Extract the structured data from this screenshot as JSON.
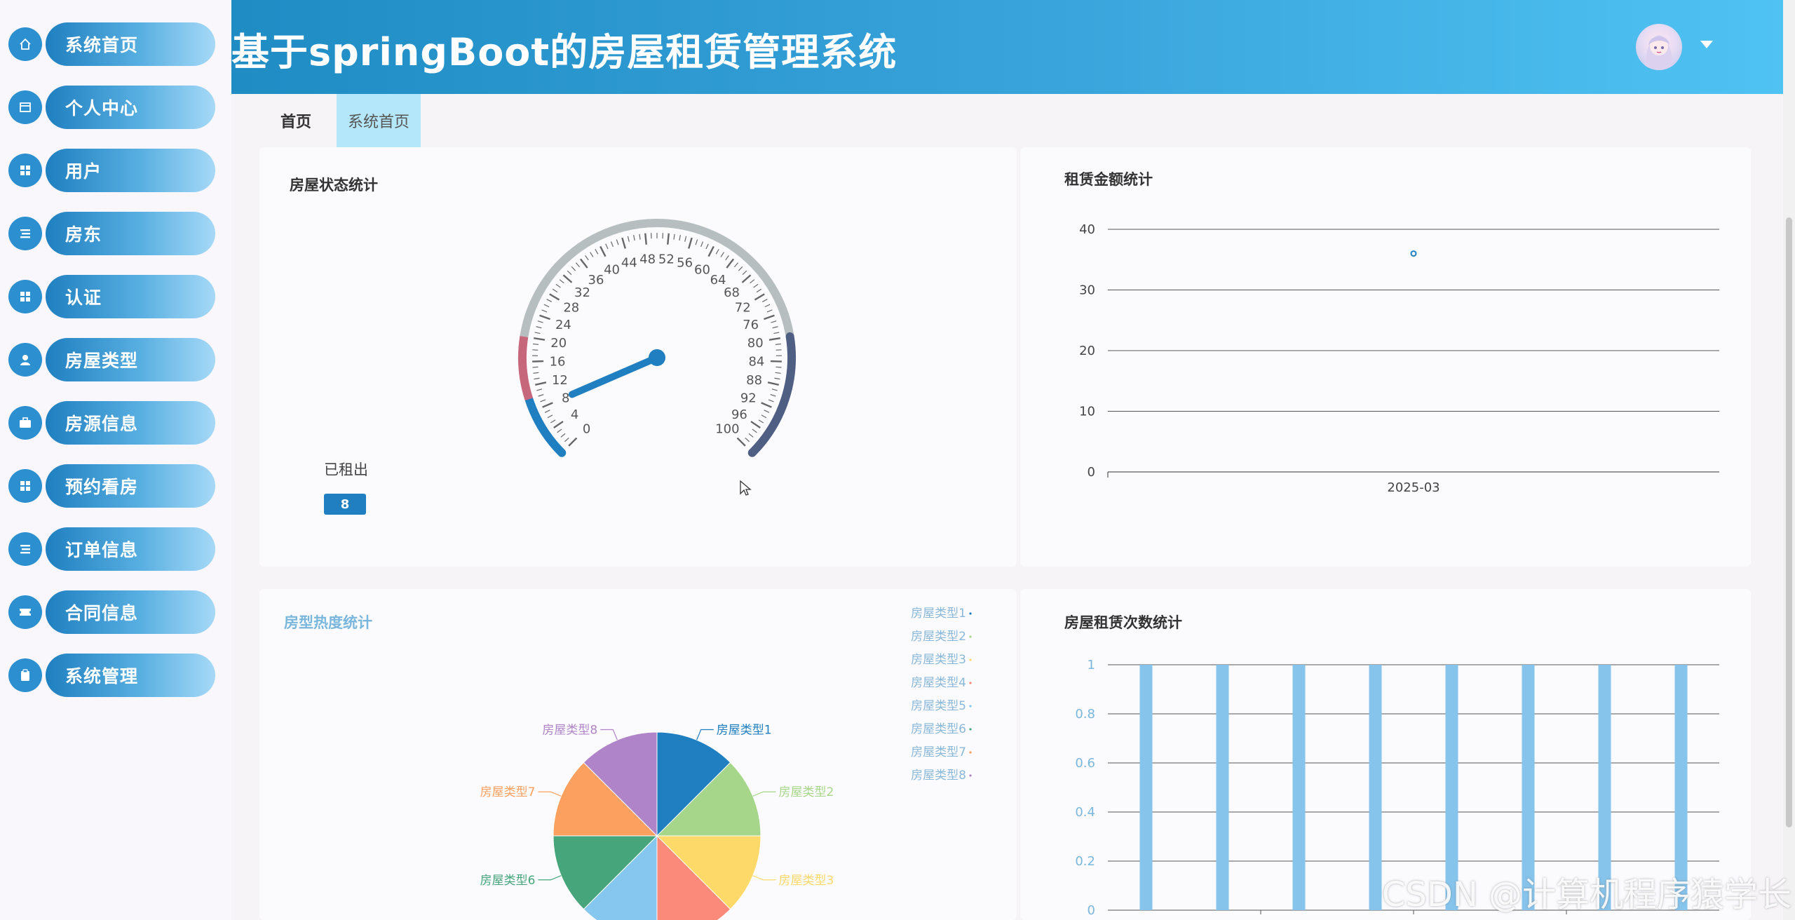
{
  "app": {
    "title": "基于springBoot的房屋租赁管理系统"
  },
  "sidebar": {
    "items": [
      {
        "label": "系统首页",
        "icon": "home-icon"
      },
      {
        "label": "个人中心",
        "icon": "card-icon"
      },
      {
        "label": "用户",
        "icon": "grid-icon"
      },
      {
        "label": "房东",
        "icon": "list-icon"
      },
      {
        "label": "认证",
        "icon": "grid-icon"
      },
      {
        "label": "房屋类型",
        "icon": "person-icon"
      },
      {
        "label": "房源信息",
        "icon": "briefcase-icon"
      },
      {
        "label": "预约看房",
        "icon": "grid-icon"
      },
      {
        "label": "订单信息",
        "icon": "list-icon"
      },
      {
        "label": "合同信息",
        "icon": "ticket-icon"
      },
      {
        "label": "系统管理",
        "icon": "clipboard-icon"
      }
    ]
  },
  "tabs": {
    "home": "首页",
    "dashboard": "系统首页"
  },
  "colors": {
    "accent": "#1f7fc0",
    "header_start": "#1f8cc4",
    "header_end": "#4fc3f3",
    "active_tab": "#b5e7fb"
  },
  "gauge_card": {
    "title": "房屋状态统计",
    "status_label": "已租出",
    "value": 8,
    "value_text": "8",
    "min": 0,
    "max": 100,
    "ticks": [
      "0",
      "4",
      "8",
      "12",
      "16",
      "20",
      "24",
      "28",
      "32",
      "36",
      "40",
      "44",
      "48",
      "52",
      "56",
      "60",
      "64",
      "68",
      "72",
      "76",
      "80",
      "84",
      "88",
      "92",
      "96",
      "100"
    ]
  },
  "cursor": {
    "icon": "mouse-pointer-icon"
  },
  "watermark": "CSDN @计算机程序猿学长",
  "chart_data": [
    {
      "type": "scatter",
      "title": "租赁金额统计",
      "x": [
        "2025-03"
      ],
      "y": [
        36
      ],
      "ylim": [
        0,
        40
      ],
      "yticks": [
        "0",
        "10",
        "20",
        "30",
        "40"
      ],
      "grid": true,
      "color": "#1f7fc0"
    },
    {
      "type": "pie",
      "title": "房型热度统计",
      "labels": [
        "房屋类型1",
        "房屋类型2",
        "房屋类型3",
        "房屋类型4",
        "房屋类型5",
        "房屋类型6",
        "房屋类型7",
        "房屋类型8"
      ],
      "values": [
        1,
        1,
        1,
        1,
        1,
        1,
        1,
        1
      ],
      "colors": [
        "#1f7fc0",
        "#a6d68a",
        "#fcd969",
        "#fc8a7a",
        "#86c7ef",
        "#46a57b",
        "#fca05f",
        "#af84c8"
      ],
      "legend": "top-right"
    },
    {
      "type": "bar",
      "title": "房屋租赁次数统计",
      "categories": [
        "",
        "",
        "",
        "",
        "",
        "",
        "",
        ""
      ],
      "values": [
        1,
        1,
        1,
        1,
        1,
        1,
        1,
        1
      ],
      "ylim": [
        0,
        1
      ],
      "yticks": [
        "0",
        "0.2",
        "0.4",
        "0.6",
        "0.8",
        "1"
      ],
      "grid": true,
      "color": "#86c4ec"
    }
  ]
}
